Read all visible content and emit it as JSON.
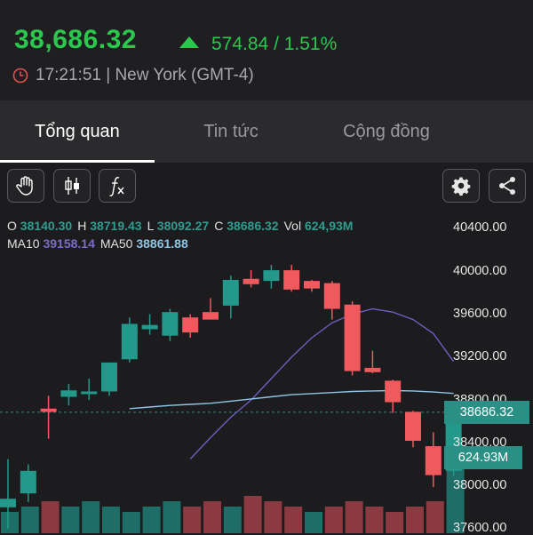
{
  "quote": {
    "price": "38,686.32",
    "change": "574.84 / 1.51%",
    "time_location": "17:21:51 | New York (GMT-4)"
  },
  "tabs": [
    {
      "label": "Tổng quan",
      "active": true
    },
    {
      "label": "Tin tức",
      "active": false
    },
    {
      "label": "Cộng đồng",
      "active": false
    }
  ],
  "toolbar": {
    "left_icons": [
      "hand-pointer-icon",
      "candlestick-icon",
      "function-fx-icon"
    ],
    "right_icons": [
      "gear-icon",
      "share-icon"
    ]
  },
  "ohlc": {
    "o_label": "O",
    "o": "38140.30",
    "h_label": "H",
    "h": "38719.43",
    "l_label": "L",
    "l": "38092.27",
    "c_label": "C",
    "c": "38686.32",
    "vol_label": "Vol",
    "vol": "624,93M"
  },
  "ma": {
    "ma10_label": "MA10",
    "ma10": "39158.14",
    "ma50_label": "MA50",
    "ma50": "38861.88"
  },
  "price_axis": [
    "40400.00",
    "40000.00",
    "39600.00",
    "39200.00",
    "38800.00",
    "38400.00",
    "38000.00",
    "37600.00"
  ],
  "last_price_label": "38686.32",
  "volume_label": "624.93M",
  "colors": {
    "up": "#2bc84d",
    "candle_up": "#22998a",
    "candle_down": "#f05a5f",
    "ma10": "#6a5fc0",
    "ma50": "#8ec5e8"
  },
  "chart_data": {
    "type": "candlestick",
    "ylim": [
      37600,
      40400
    ],
    "candles": [
      {
        "o": 37800,
        "h": 38250,
        "l": 37600,
        "c": 37880
      },
      {
        "o": 37930,
        "h": 38200,
        "l": 37850,
        "c": 38140
      },
      {
        "o": 38720,
        "h": 38840,
        "l": 38440,
        "c": 38690
      },
      {
        "o": 38830,
        "h": 38950,
        "l": 38750,
        "c": 38890
      },
      {
        "o": 38860,
        "h": 39000,
        "l": 38800,
        "c": 38880
      },
      {
        "o": 38880,
        "h": 39150,
        "l": 38840,
        "c": 39150
      },
      {
        "o": 39180,
        "h": 39570,
        "l": 39150,
        "c": 39510
      },
      {
        "o": 39460,
        "h": 39600,
        "l": 39410,
        "c": 39500
      },
      {
        "o": 39400,
        "h": 39650,
        "l": 39350,
        "c": 39620
      },
      {
        "o": 39570,
        "h": 39600,
        "l": 39380,
        "c": 39430
      },
      {
        "o": 39620,
        "h": 39750,
        "l": 39580,
        "c": 39550
      },
      {
        "o": 39680,
        "h": 39960,
        "l": 39560,
        "c": 39920
      },
      {
        "o": 39930,
        "h": 40010,
        "l": 39850,
        "c": 39880
      },
      {
        "o": 39910,
        "h": 40060,
        "l": 39840,
        "c": 40010
      },
      {
        "o": 40010,
        "h": 40060,
        "l": 39810,
        "c": 39830
      },
      {
        "o": 39910,
        "h": 39920,
        "l": 39810,
        "c": 39840
      },
      {
        "o": 39890,
        "h": 39910,
        "l": 39550,
        "c": 39650
      },
      {
        "o": 39690,
        "h": 39720,
        "l": 39030,
        "c": 39070
      },
      {
        "o": 39100,
        "h": 39260,
        "l": 39050,
        "c": 39060
      },
      {
        "o": 38980,
        "h": 38990,
        "l": 38680,
        "c": 38780
      },
      {
        "o": 38690,
        "h": 38700,
        "l": 38360,
        "c": 38420
      },
      {
        "o": 38370,
        "h": 38500,
        "l": 37990,
        "c": 38100
      },
      {
        "o": 38140,
        "h": 38719,
        "l": 38092,
        "c": 38686
      }
    ],
    "ma10": [
      null,
      null,
      null,
      null,
      null,
      null,
      null,
      null,
      null,
      38250,
      38450,
      38640,
      38800,
      39000,
      39200,
      39380,
      39520,
      39600,
      39650,
      39620,
      39550,
      39420,
      39160
    ],
    "ma50": [
      null,
      null,
      null,
      null,
      null,
      null,
      38720,
      38735,
      38750,
      38760,
      38770,
      38790,
      38810,
      38830,
      38850,
      38860,
      38870,
      38880,
      38885,
      38888,
      38885,
      38875,
      38862
    ],
    "volume_up": [
      true,
      true,
      false,
      true,
      true,
      true,
      true,
      true,
      true,
      false,
      false,
      true,
      false,
      false,
      false,
      true,
      false,
      false,
      false,
      false,
      false,
      false,
      true
    ],
    "volume_relative": [
      0.2,
      0.25,
      0.3,
      0.25,
      0.3,
      0.25,
      0.2,
      0.25,
      0.3,
      0.25,
      0.3,
      0.25,
      0.35,
      0.3,
      0.25,
      0.2,
      0.25,
      0.3,
      0.25,
      0.2,
      0.25,
      0.3,
      0.8
    ]
  }
}
